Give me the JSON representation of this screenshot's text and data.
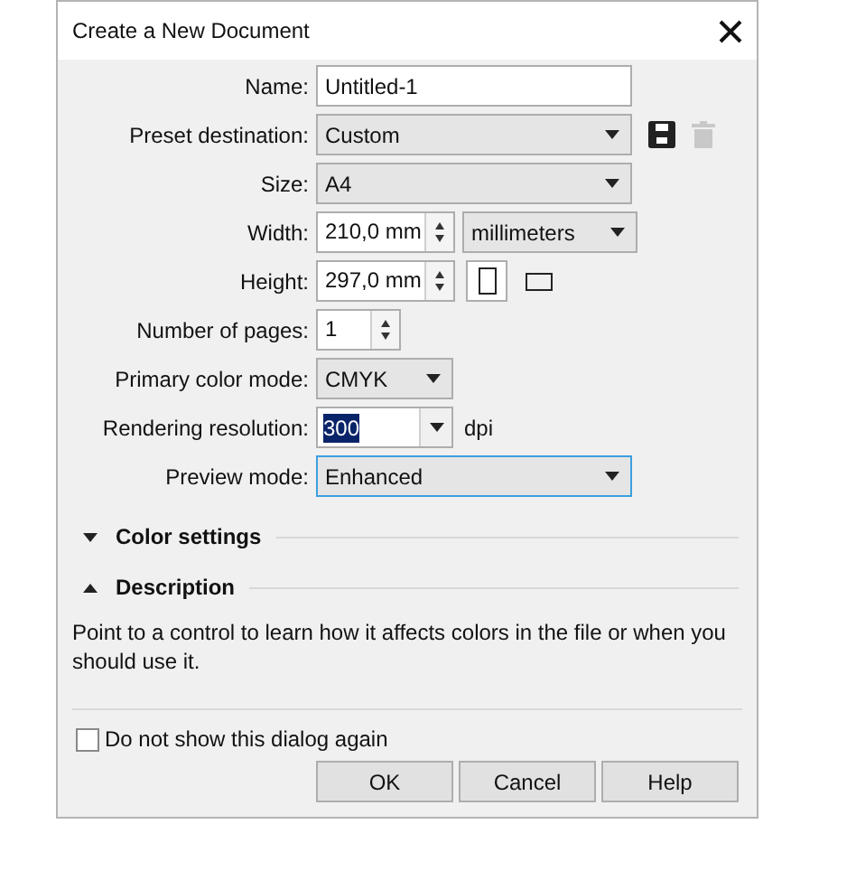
{
  "window": {
    "title": "Create a New Document"
  },
  "fields": [
    {
      "kind": "text",
      "label": "Name:",
      "value": "Untitled-1"
    },
    {
      "kind": "preset",
      "label": "Preset destination:",
      "value": "Custom",
      "delete_disabled": true
    },
    {
      "kind": "dropdown",
      "label": "Size:",
      "value": "A4"
    },
    {
      "kind": "spinner-units",
      "label": "Width:",
      "value": "210,0 mm",
      "units": "millimeters"
    },
    {
      "kind": "spinner-orientation",
      "label": "Height:",
      "value": "297,0 mm",
      "orientations": [
        {
          "selected": true
        },
        {
          "selected": false
        }
      ]
    },
    {
      "kind": "short-spinner",
      "label": "Number of pages:",
      "value": "1"
    },
    {
      "kind": "short-dropdown",
      "label": "Primary color mode:",
      "value": "CMYK"
    },
    {
      "kind": "combo",
      "label": "Rendering resolution:",
      "value": "300",
      "value_selected": true,
      "suffix": "dpi"
    },
    {
      "kind": "dropdown",
      "label": "Preview mode:",
      "value": "Enhanced",
      "focused": true
    }
  ],
  "sections": [
    {
      "title": "Color settings",
      "expanded": false
    },
    {
      "title": "Description",
      "expanded": true
    }
  ],
  "description": "Point to a control to learn how it affects colors in the file or when you should use it.",
  "checkbox": {
    "label": "Do not show this dialog again",
    "checked": false
  },
  "buttons": [
    "OK",
    "Cancel",
    "Help"
  ]
}
